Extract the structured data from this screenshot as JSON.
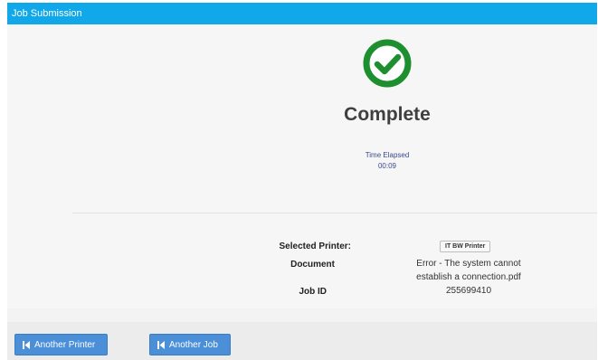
{
  "window": {
    "title": "Job Submission"
  },
  "status": {
    "title": "Complete",
    "elapsed_label": "Time Elapsed",
    "elapsed_value": "00:09",
    "icon": "check-circle-icon",
    "icon_color": "#1e8f2e"
  },
  "details": {
    "printer_label": "Selected Printer:",
    "printer_value": "IT BW Printer",
    "document_label": "Document",
    "document_line1": "Error - The system cannot",
    "document_line2": "establish a connection.pdf",
    "jobid_label": "Job ID",
    "jobid_value": "255699410"
  },
  "footer": {
    "another_printer_label": "Another Printer",
    "another_job_label": "Another Job",
    "icon": "skip-back-icon",
    "button_color": "#4a8fd8"
  },
  "colors": {
    "titlebar": "#10a8e8"
  }
}
